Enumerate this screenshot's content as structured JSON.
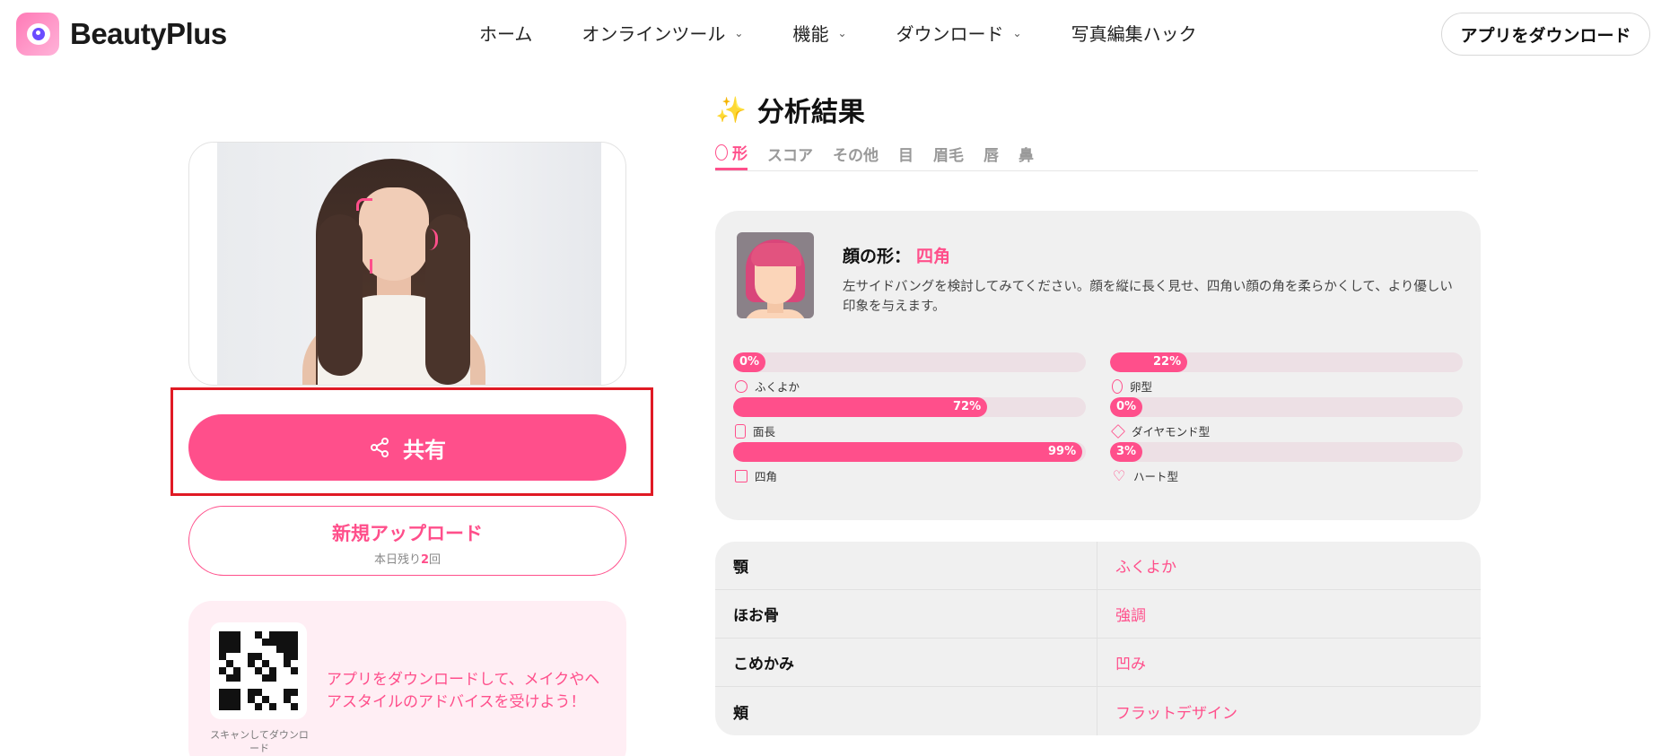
{
  "header": {
    "brand": "BeautyPlus",
    "nav": [
      {
        "label": "ホーム",
        "dropdown": false
      },
      {
        "label": "オンラインツール",
        "dropdown": true
      },
      {
        "label": "機能",
        "dropdown": true
      },
      {
        "label": "ダウンロード",
        "dropdown": true
      },
      {
        "label": "写真編集ハック",
        "dropdown": false
      }
    ],
    "download_label": "アプリをダウンロード"
  },
  "left": {
    "share_label": "共有",
    "upload_title": "新規アップロード",
    "upload_sub_prefix": "本日残り",
    "upload_sub_count": "2",
    "upload_sub_suffix": "回",
    "qr_caption": "スキャンしてダウンロード",
    "promo_text": "アプリをダウンロードして、メイクやヘアスタイルのアドバイスを受けよう！"
  },
  "result": {
    "title": "分析結果",
    "tabs": [
      "形",
      "スコア",
      "その他",
      "目",
      "眉毛",
      "唇",
      "鼻"
    ],
    "active_tab": 0,
    "shape_label": "顔の形：",
    "shape_value": "四角",
    "shape_desc": "左サイドバングを検討してみてください。顔を縦に長く見せ、四角い顔の角を柔らかくして、より優しい印象を与えます。",
    "bars": [
      {
        "label": "ふくよか",
        "percent": 0,
        "pct_text": "0%",
        "icon": "circle-outline-icon"
      },
      {
        "label": "卵型",
        "percent": 22,
        "pct_text": "22%",
        "icon": "oval-outline-icon"
      },
      {
        "label": "面長",
        "percent": 72,
        "pct_text": "72%",
        "icon": "long-rect-outline-icon"
      },
      {
        "label": "ダイヤモンド型",
        "percent": 0,
        "pct_text": "0%",
        "icon": "diamond-outline-icon"
      },
      {
        "label": "四角",
        "percent": 99,
        "pct_text": "99%",
        "icon": "square-outline-icon"
      },
      {
        "label": "ハート型",
        "percent": 3,
        "pct_text": "3%",
        "icon": "heart-outline-icon"
      }
    ],
    "features": [
      {
        "key": "顎",
        "value": "ふくよか"
      },
      {
        "key": "ほお骨",
        "value": "強調"
      },
      {
        "key": "こめかみ",
        "value": "凹み"
      },
      {
        "key": "頬",
        "value": "フラットデザイン"
      }
    ]
  },
  "colors": {
    "accent": "#ff4f8b",
    "highlight_box": "#e01a24",
    "card_bg": "#f0f0f0",
    "promo_bg": "#ffeef4"
  }
}
